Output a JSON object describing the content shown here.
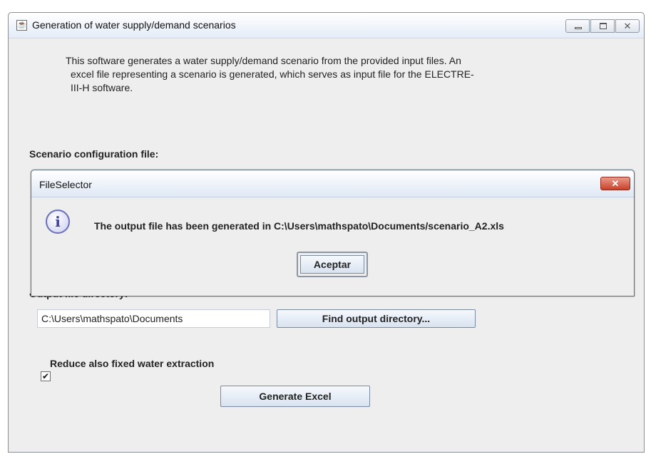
{
  "window": {
    "title": "Generation of water supply/demand scenarios",
    "icon": "java-icon",
    "controls": [
      "minimize-icon",
      "maximize-icon",
      "close-icon"
    ]
  },
  "description": {
    "line1": "This software generates a water supply/demand scenario from the provided input files. An",
    "line2": "excel file representing a scenario is generated, which serves as input file for the ELECTRE-",
    "line3": "III-H software."
  },
  "scenario_config": {
    "label": "Scenario configuration file:"
  },
  "output_dir": {
    "label": "Output file directory:",
    "value": "C:\\Users\\mathspato\\Documents",
    "button": "Find output directory..."
  },
  "reduce_fixed": {
    "label": "Reduce also fixed water extraction",
    "checked": true
  },
  "generate_button": "Generate Excel",
  "dialog": {
    "title": "FileSelector",
    "message": "The output file has been generated in C:\\Users\\mathspato\\Documents/scenario_A2.xls",
    "ok_button": "Aceptar",
    "icon": "info-icon",
    "close_icon": "close-icon"
  },
  "colors": {
    "window_bg": "#eeeeee",
    "titlebar": "#e4ecf7",
    "close_red": "#c9412a"
  }
}
